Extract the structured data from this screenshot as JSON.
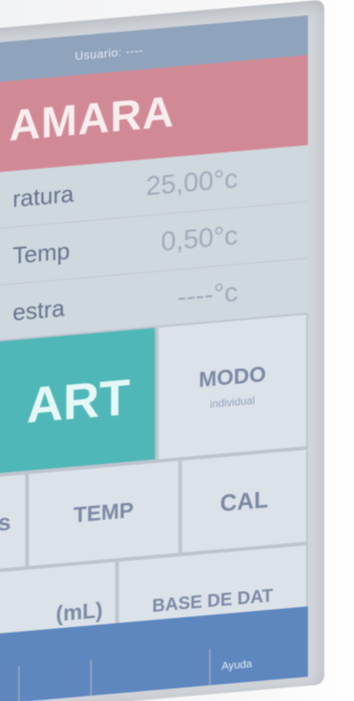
{
  "statusbar": {
    "user_label": "Usuario: ----"
  },
  "header": {
    "title": "AMARA"
  },
  "readings": [
    {
      "label": "ratura",
      "value": "25,00°c"
    },
    {
      "label": "Temp",
      "value": "0,50°c"
    },
    {
      "label": "estra",
      "value": "----°c"
    }
  ],
  "buttons": {
    "start": "ART",
    "modo": "MODO",
    "modo_sub": "individual",
    "left_fragment": "s",
    "temp": "TEMP",
    "cal": "CAL",
    "bottom_left": "(mL)",
    "base": "BASE DE DAT"
  },
  "bottom_tabs": [
    "",
    "",
    "",
    "Ayuda"
  ],
  "colors": {
    "title_bg": "#d18a95",
    "start_bg": "#4fb7b7",
    "statusbar_bg": "#90a3bd",
    "bottom_bar_bg": "#5e86bf"
  }
}
